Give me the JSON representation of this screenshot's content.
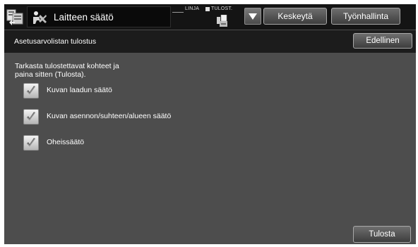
{
  "header": {
    "title": "Laitteen säätö",
    "status_line": "LINJA",
    "status_print": "TULOST.",
    "interrupt_label": "Keskeytä",
    "job_control_label": "Työnhallinta"
  },
  "subheader": {
    "title": "Asetusarvolistan tulostus",
    "back_label": "Edellinen"
  },
  "content": {
    "instruction_line1": "Tarkasta tulostettavat kohteet ja",
    "instruction_line2": "paina sitten (Tulosta).",
    "items": [
      {
        "label": "Kuvan laadun säätö",
        "checked": true
      },
      {
        "label": "Kuvan asennon/suhteen/alueen säätö",
        "checked": true
      },
      {
        "label": "Oheissäätö",
        "checked": true
      }
    ],
    "print_label": "Tulosta"
  },
  "icons": {
    "home": "home-icon",
    "title": "device-adjust-icon",
    "printer": "printer-icon",
    "dropdown": "dropdown-arrow-icon",
    "check": "checkmark-icon"
  }
}
